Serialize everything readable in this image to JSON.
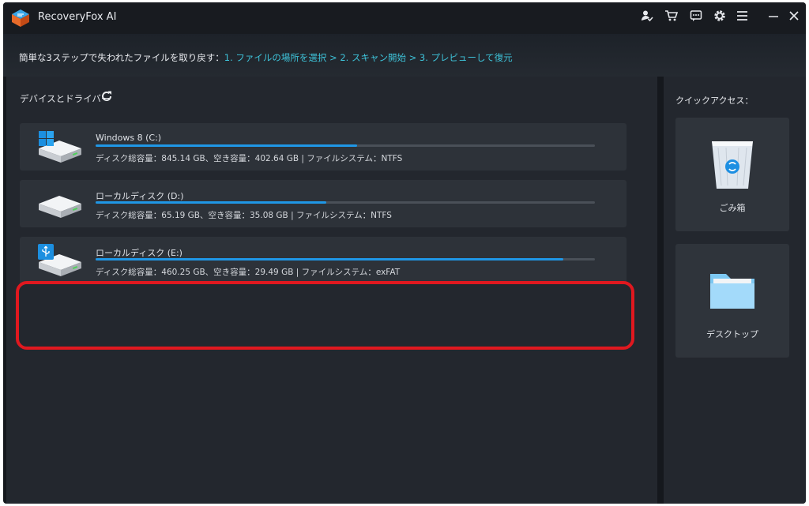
{
  "app": {
    "title": "RecoveryFox AI"
  },
  "titlebar": {
    "icons": [
      "account-icon",
      "cart-icon",
      "feedback-icon",
      "settings-icon",
      "menu-icon",
      "minimize-icon",
      "close-icon"
    ]
  },
  "banner": {
    "prefix": "簡単な3ステップで失われたファイルを取り戻す：",
    "steps": "1. ファイルの場所を選択 > 2. スキャン開始 > 3. プレビューして復元"
  },
  "devices": {
    "title": "デバイスとドライバー",
    "drives": [
      {
        "name": "Windows 8 (C:)",
        "info": "ディスク総容量：845.14 GB、空き容量：402.64 GB | ファイルシステム：NTFS",
        "used_fraction": 0.524,
        "icon": "windows-drive-icon"
      },
      {
        "name": "ローカルディスク (D:)",
        "info": "ディスク総容量：65.19 GB、空き容量：35.08 GB | ファイルシステム：NTFS",
        "used_fraction": 0.462,
        "icon": "hard-drive-icon"
      },
      {
        "name": "ローカルディスク (E:)",
        "info": "ディスク総容量：460.25 GB、空き容量：29.49 GB | ファイルシステム：exFAT",
        "used_fraction": 0.936,
        "icon": "usb-drive-icon"
      }
    ]
  },
  "quick_access": {
    "title": "クイックアクセス：",
    "items": [
      {
        "label": "ごみ箱",
        "icon": "recycle-bin-icon"
      },
      {
        "label": "デスクトップ",
        "icon": "folder-icon"
      }
    ]
  },
  "colors": {
    "accent": "#1f97e6",
    "steps_text": "#3ec3d9",
    "highlight": "#e0181f",
    "panel": "#23272e",
    "card": "#2d3239"
  }
}
